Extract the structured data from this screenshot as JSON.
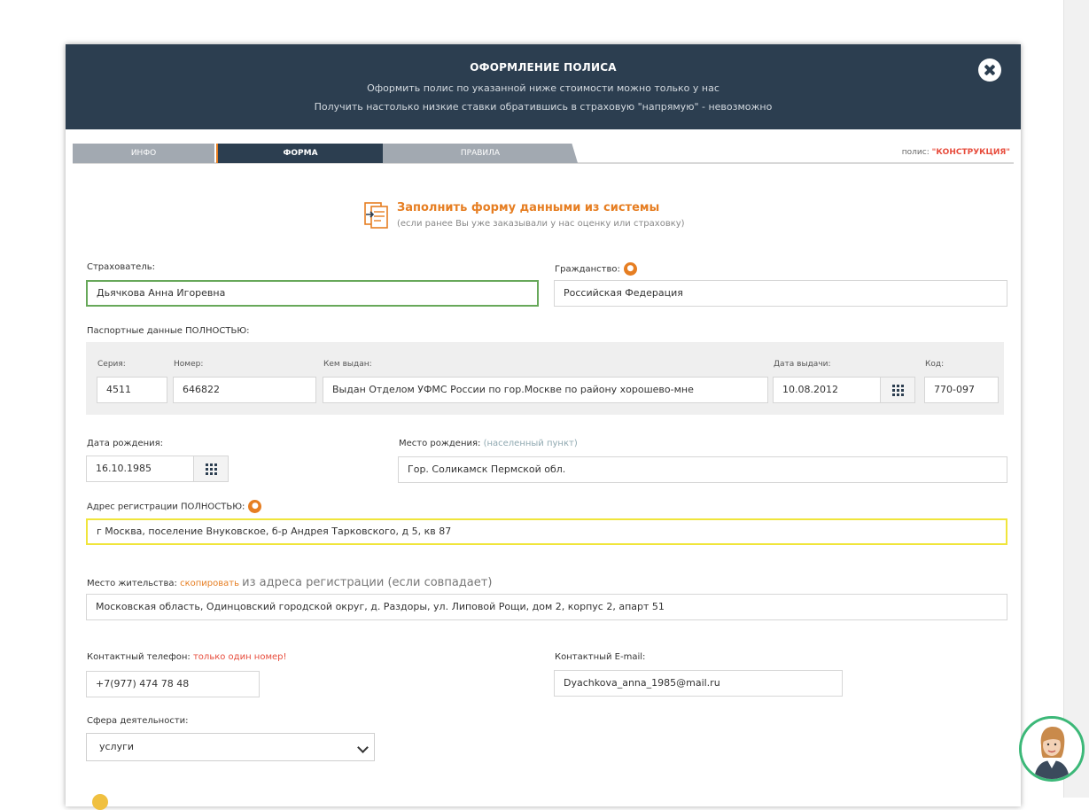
{
  "modal": {
    "title": "ОФОРМЛЕНИЕ ПОЛИСА",
    "subtitle_line1": "Оформить полис по указанной ниже стоимости можно только у нас",
    "subtitle_line2": "Получить настолько низкие ставки обратившись в страховую \"напрямую\" - невозможно",
    "close_icon": "close-circle-icon"
  },
  "tabs": [
    {
      "label": "ИНФО"
    },
    {
      "label": "ФОРМА"
    },
    {
      "label": "ПРАВИЛА"
    }
  ],
  "policy": {
    "label": "полис:",
    "value": "\"КОНСТРУКЦИЯ\""
  },
  "fill_from_system": {
    "link": "Заполнить форму данными из системы",
    "note": "(если ранее Вы уже заказывали у нас оценку или страховку)",
    "icon": "document-import-icon"
  },
  "form": {
    "insurer_label": "Страхователь:",
    "insurer_value": "Дьячкова Анна Игоревна",
    "citizenship_label": "Гражданство:",
    "citizenship_value": "Российская Федерация",
    "passport_label": "Паспортные данные ПОЛНОСТЬЮ:",
    "passport": {
      "series_label": "Серия:",
      "series_value": "4511",
      "number_label": "Номер:",
      "number_value": "646822",
      "issued_by_label": "Кем выдан:",
      "issued_by_value": "Выдан Отделом УФМС России по гор.Москве по району хорошево-мне",
      "issue_date_label": "Дата выдачи:",
      "issue_date_value": "10.08.2012",
      "code_label": "Код:",
      "code_value": "770-097"
    },
    "birth_date_label": "Дата рождения:",
    "birth_date_value": "16.10.1985",
    "birth_place_label": "Место рождения:",
    "birth_place_hint": "(населенный пункт)",
    "birth_place_value": "Гор. Соликамск Пермской обл.",
    "reg_address_label": "Адрес регистрации ПОЛНОСТЬЮ:",
    "reg_address_value": "г Москва, поселение Внуковское, б-р Андрея Тарковского, д 5, кв 87",
    "residence_label": "Место жительства:",
    "residence_copy_link": "скопировать",
    "residence_copy_rest": "из адреса регистрации (если совпадает)",
    "residence_value": "Московская область, Одинцовский городской округ, д. Раздоры, ул. Липовой Рощи, дом 2, корпус 2, апарт 51",
    "phone_label": "Контактный телефон:",
    "phone_note": "только один номер!",
    "phone_value": "+7(977) 474 78 48",
    "email_label": "Контактный E-mail:",
    "email_value": "Dyachkova_anna_1985@mail.ru",
    "activity_label": "Сфера деятельности:",
    "activity_value": "услуги"
  },
  "colors": {
    "header_bg": "#2c3e50",
    "accent_orange": "#e67e22",
    "field_active_green": "#67a85a",
    "field_highlight_yellow": "#f0e53b",
    "warning_red": "#e74c3c",
    "chat_ring": "#3cb878"
  },
  "icons": {
    "info": "info-dot-icon",
    "calendar": "calendar-icon",
    "dropdown": "chevron-down-icon",
    "chat": "support-avatar-icon"
  }
}
